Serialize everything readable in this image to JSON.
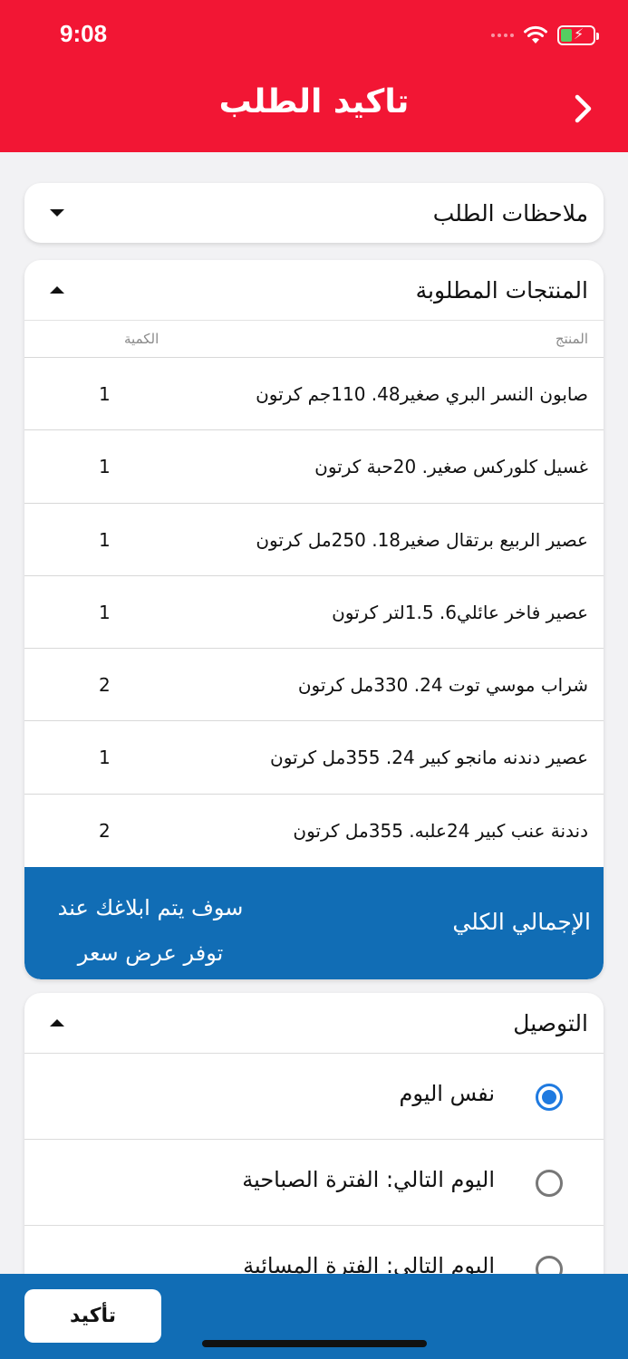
{
  "status": {
    "time": "9:08"
  },
  "header": {
    "title": "تاكيد الطلب"
  },
  "notes_section": {
    "title": "ملاحظات الطلب"
  },
  "products_section": {
    "title": "المنتجات المطلوبة",
    "col_product": "المنتج",
    "col_qty": "الكمية",
    "rows": [
      {
        "name": "صابون النسر البري صغير48. 110جم كرتون",
        "qty": "1"
      },
      {
        "name": "غسيل كلوركس صغير. 20حبة كرتون",
        "qty": "1"
      },
      {
        "name": "عصير الربيع  برتقال صغير18. 250مل كرتون",
        "qty": "1"
      },
      {
        "name": "عصير فاخر عائلي6. 1.5لتر كرتون",
        "qty": "1"
      },
      {
        "name": "شراب موسي توت 24. 330مل كرتون",
        "qty": "2"
      },
      {
        "name": "عصير دندنه مانجو كبير 24.  355مل كرتون",
        "qty": "1"
      },
      {
        "name": "دندنة عنب كبير 24علبه. 355مل كرتون",
        "qty": "2"
      }
    ],
    "total_label": "الإجمالي الكلي",
    "total_note": "سوف يتم ابلاغك عند توفر عرض سعر"
  },
  "delivery_section": {
    "title": "التوصيل",
    "options": [
      {
        "label": "نفس اليوم",
        "selected": true
      },
      {
        "label": "اليوم التالي: الفترة الصباحية",
        "selected": false
      },
      {
        "label": "اليوم التالي: الفترة المسائية",
        "selected": false
      }
    ]
  },
  "footer": {
    "confirm_label": "تأكيد"
  },
  "colors": {
    "header": "#f21634",
    "accent_blue": "#116db5",
    "radio_selected": "#1f7ae0"
  }
}
